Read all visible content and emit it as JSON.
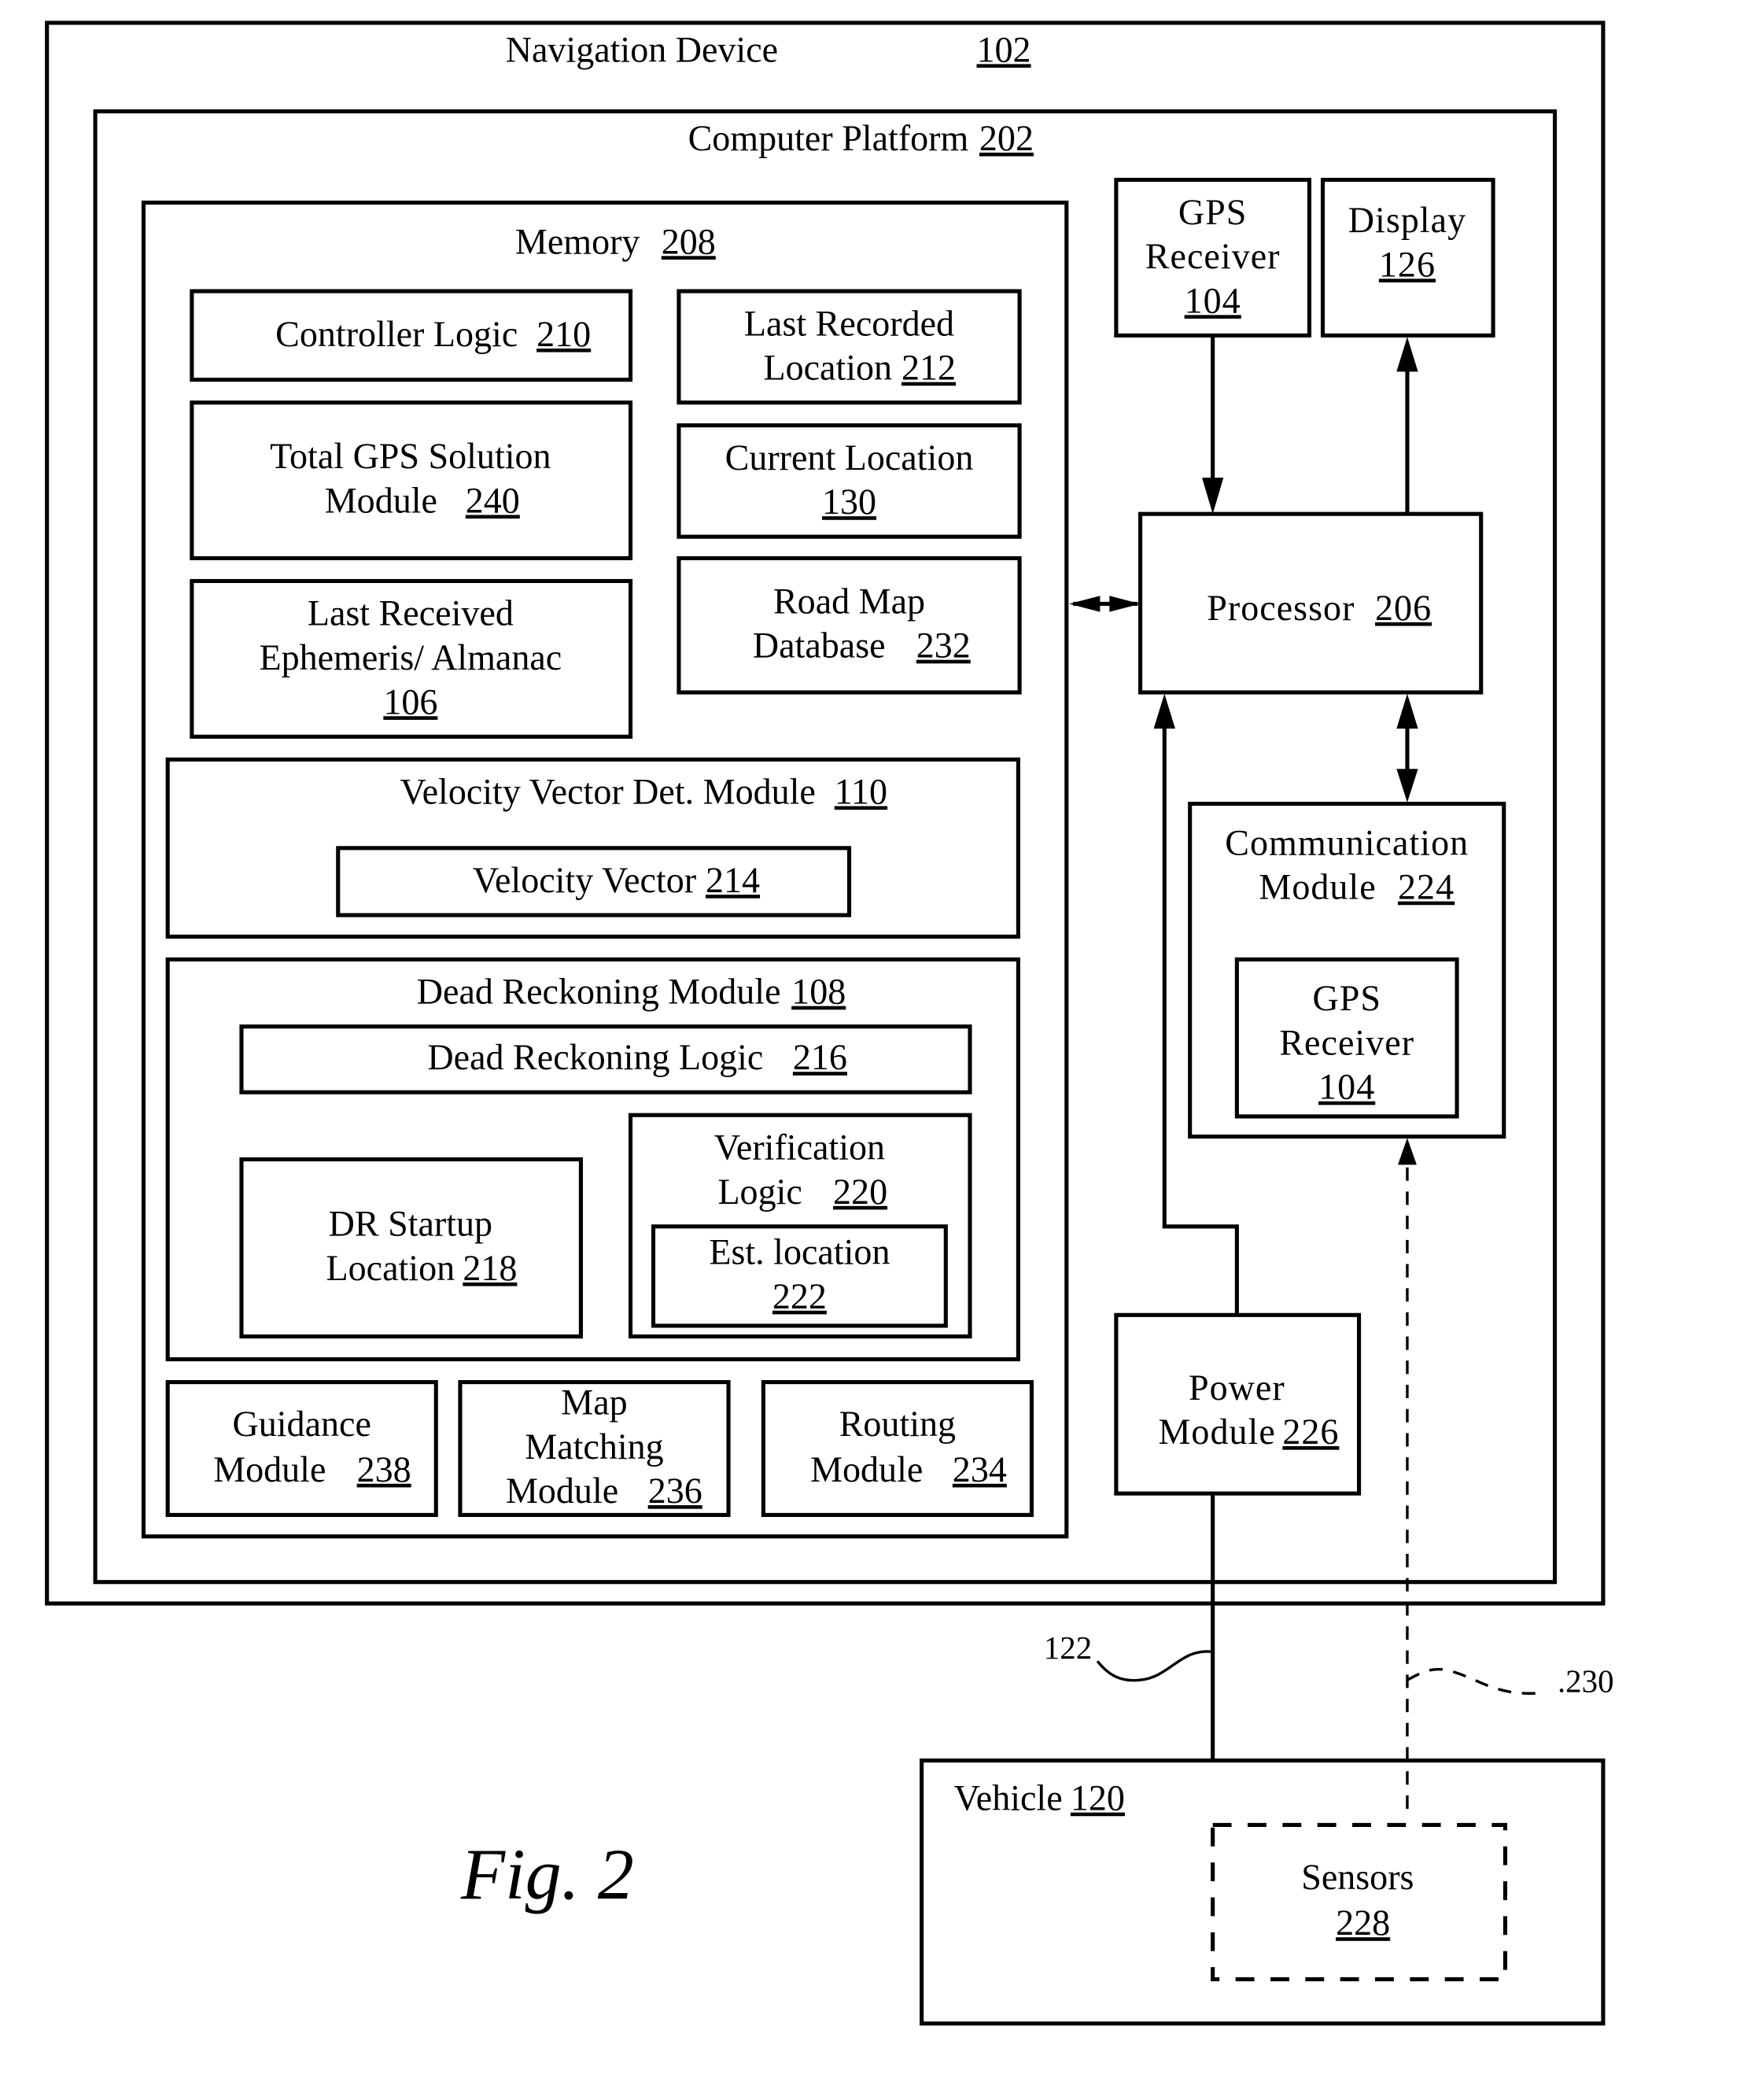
{
  "navigation_device": {
    "label": "Navigation Device",
    "ref": "102"
  },
  "computer_platform": {
    "label": "Computer  Platform",
    "ref": "202"
  },
  "memory": {
    "label": "Memory",
    "ref": "208",
    "controller_logic": {
      "label": "Controller Logic",
      "ref": "210"
    },
    "last_recorded_location": {
      "line1": "Last Recorded",
      "line2": "Location",
      "ref": "212"
    },
    "total_gps_solution": {
      "line1": "Total GPS Solution",
      "line2": "Module",
      "ref": "240"
    },
    "current_location": {
      "line1": "Current Location",
      "ref": "130"
    },
    "last_received_ephemeris": {
      "line1": "Last Received",
      "line2": "Ephemeris/ Almanac",
      "ref": "106"
    },
    "road_map_database": {
      "line1": "Road Map",
      "line2": "Database",
      "ref": "232"
    },
    "velocity_vector_module": {
      "label": "Velocity Vector Det.  Module",
      "ref": "110",
      "velocity_vector": {
        "label": "Velocity Vector",
        "ref": "214"
      }
    },
    "dead_reckoning_module": {
      "label": "Dead Reckoning Module",
      "ref": "108",
      "dead_reckoning_logic": {
        "label": "Dead Reckoning Logic",
        "ref": "216"
      },
      "dr_startup_location": {
        "line1": "DR Startup",
        "line2": "Location",
        "ref": "218"
      },
      "verification_logic": {
        "line1": "Verification",
        "line2": "Logic",
        "ref": "220",
        "est_location": {
          "line1": "Est. location",
          "ref": "222"
        }
      }
    },
    "guidance_module": {
      "line1": "Guidance",
      "line2": "Module",
      "ref": "238"
    },
    "map_matching_module": {
      "line1": "Map",
      "line2": "Matching",
      "line3": "Module",
      "ref": "236"
    },
    "routing_module": {
      "line1": "Routing",
      "line2": "Module",
      "ref": "234"
    }
  },
  "gps_receiver": {
    "line1": "GPS",
    "line2": "Receiver",
    "ref": "104"
  },
  "display": {
    "line1": "Display",
    "ref": "126"
  },
  "processor": {
    "label": "Processor",
    "ref": "206"
  },
  "communication_module": {
    "line1": "Communication",
    "line2": "Module",
    "ref": "224",
    "gps_receiver": {
      "line1": "GPS",
      "line2": "Receiver",
      "ref": "104"
    }
  },
  "power_module": {
    "line1": "Power",
    "line2": "Module",
    "ref": "226"
  },
  "vehicle": {
    "label": "Vehicle",
    "ref": "120",
    "sensors": {
      "line1": "Sensors",
      "ref": "228"
    }
  },
  "leaders": {
    "power_link": "122",
    "sensor_link": ".230"
  },
  "figure_label": "Fig. 2"
}
